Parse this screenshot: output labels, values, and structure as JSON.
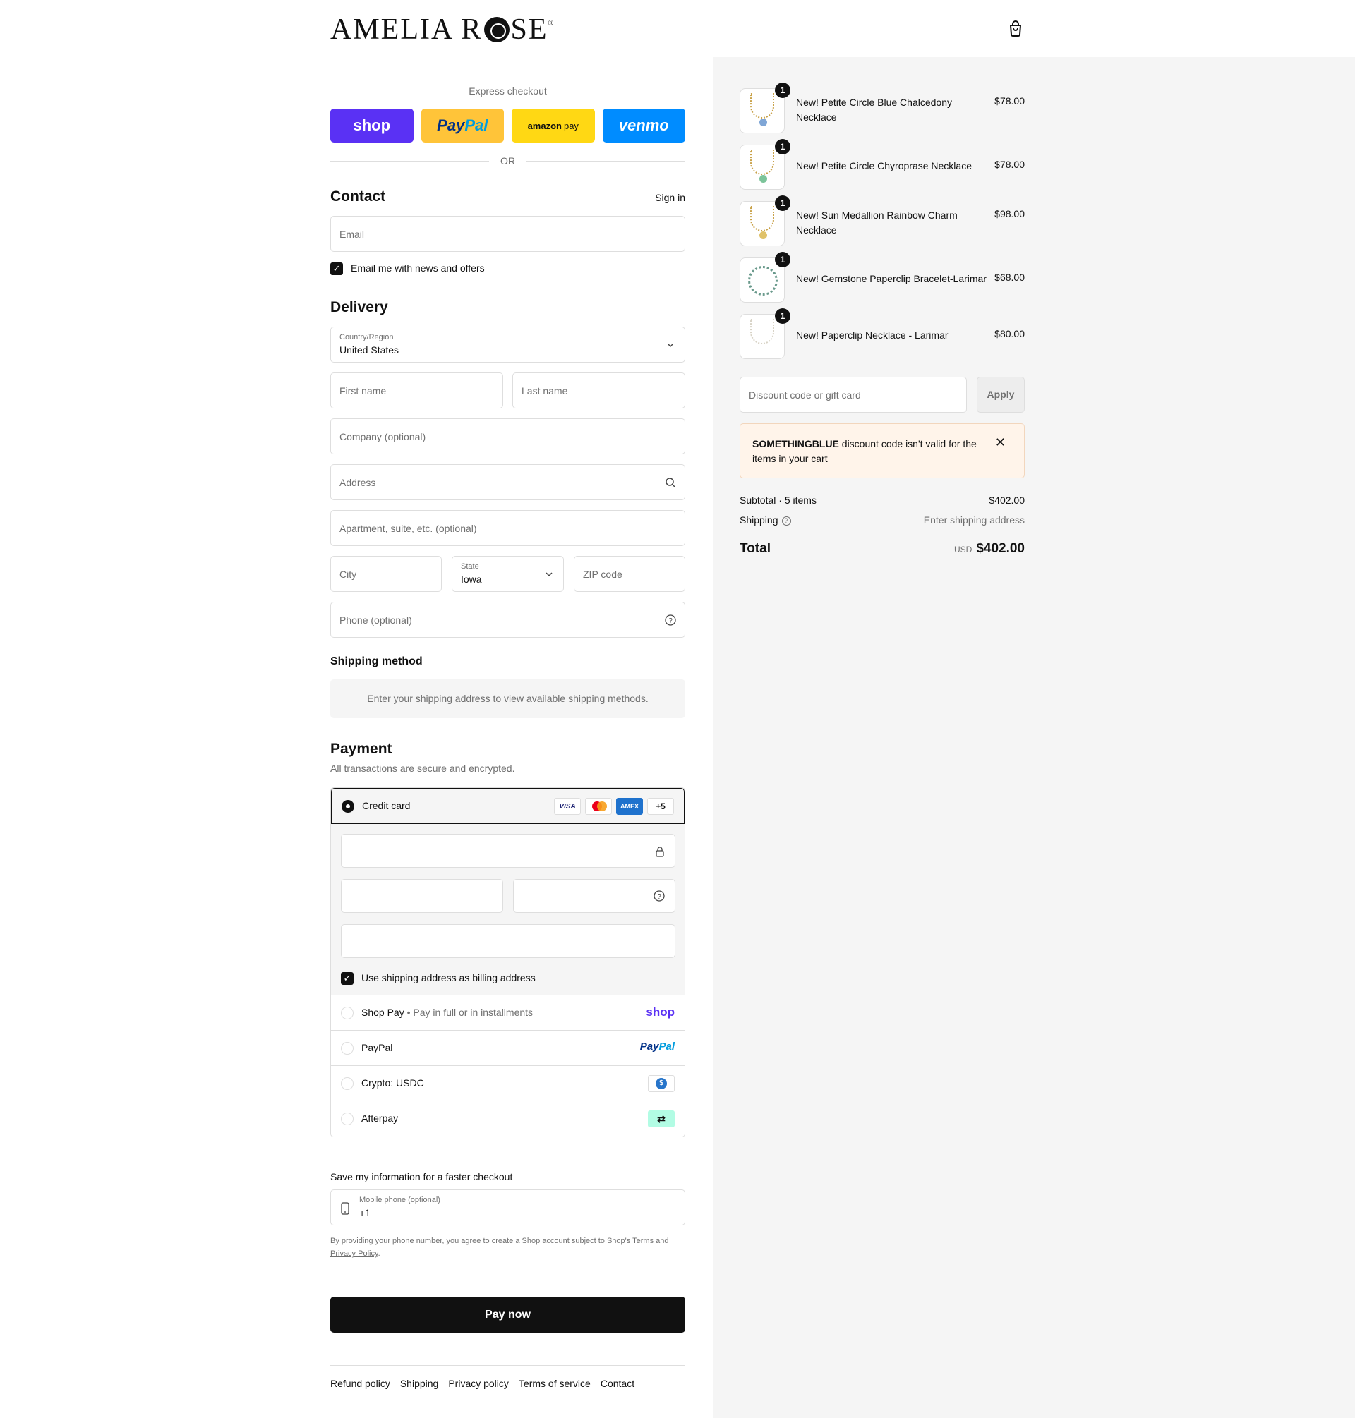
{
  "header": {
    "brand": "AMELIA R",
    "brand_tail": "SE",
    "reg": "®"
  },
  "express": {
    "title": "Express checkout",
    "shop": "shop",
    "paypal_a": "Pay",
    "paypal_b": "Pal",
    "amazon_a": "amazon",
    "amazon_b": "pay",
    "venmo": "venmo",
    "or": "OR"
  },
  "contact": {
    "title": "Contact",
    "sign_in": "Sign in",
    "email_placeholder": "Email",
    "newsletter": "Email me with news and offers"
  },
  "delivery": {
    "title": "Delivery",
    "country_label": "Country/Region",
    "country": "United States",
    "first_name": "First name",
    "last_name": "Last name",
    "company": "Company (optional)",
    "address": "Address",
    "apartment": "Apartment, suite, etc. (optional)",
    "city": "City",
    "state_label": "State",
    "state": "Iowa",
    "zip": "ZIP code",
    "phone": "Phone (optional)"
  },
  "shipping_method": {
    "title": "Shipping method",
    "info": "Enter your shipping address to view available shipping methods."
  },
  "payment": {
    "title": "Payment",
    "subtitle": "All transactions are secure and encrypted.",
    "credit_card": "Credit card",
    "card_visa": "VISA",
    "card_amex": "AMEX",
    "card_more": "+5",
    "billing_same": "Use shipping address as billing address",
    "shop_pay": "Shop Pay",
    "shop_pay_sub": "Pay in full or in installments",
    "shop_logo": "shop",
    "paypal": "PayPal",
    "paypal_logo_a": "Pay",
    "paypal_logo_b": "Pal",
    "crypto": "Crypto: USDC",
    "afterpay": "Afterpay"
  },
  "save_info": {
    "title": "Save my information for a faster checkout",
    "mobile_label": "Mobile phone (optional)",
    "mobile_value": "+1",
    "fine_a": "By providing your phone number, you agree to create a Shop account subject to Shop's ",
    "terms": "Terms",
    "fine_b": " and ",
    "privacy": "Privacy Policy",
    "fine_c": "."
  },
  "pay_now": "Pay now",
  "footer": [
    "Refund policy",
    "Shipping",
    "Privacy policy",
    "Terms of service",
    "Contact"
  ],
  "cart": {
    "items": [
      {
        "name": "New! Petite Circle Blue Chalcedony Necklace",
        "price": "$78.00",
        "qty": "1",
        "pendant": "#7fa6d6"
      },
      {
        "name": "New! Petite Circle Chyroprase Necklace",
        "price": "$78.00",
        "qty": "1",
        "pendant": "#7cc49a"
      },
      {
        "name": "New! Sun Medallion Rainbow Charm Necklace",
        "price": "$98.00",
        "qty": "1",
        "pendant": "#e0c26a"
      },
      {
        "name": "New! Gemstone Paperclip Bracelet-Larimar",
        "price": "$68.00",
        "qty": "1",
        "pendant": ""
      },
      {
        "name": "New! Paperclip Necklace - Larimar",
        "price": "$80.00",
        "qty": "1",
        "pendant": ""
      }
    ],
    "discount_placeholder": "Discount code or gift card",
    "apply": "Apply",
    "error_code": "SOMETHINGBLUE",
    "error_msg": " discount code isn't valid for the items in your cart",
    "subtotal_label": "Subtotal · 5 items",
    "subtotal": "$402.00",
    "shipping_label": "Shipping",
    "shipping_value": "Enter shipping address",
    "total_label": "Total",
    "currency": "USD",
    "total": "$402.00"
  },
  "colors": {
    "shop": "#5a31f4",
    "paypal": "#ffc439",
    "amazon": "#ffd814",
    "venmo": "#008cff",
    "error_bg": "#fff4ea"
  }
}
